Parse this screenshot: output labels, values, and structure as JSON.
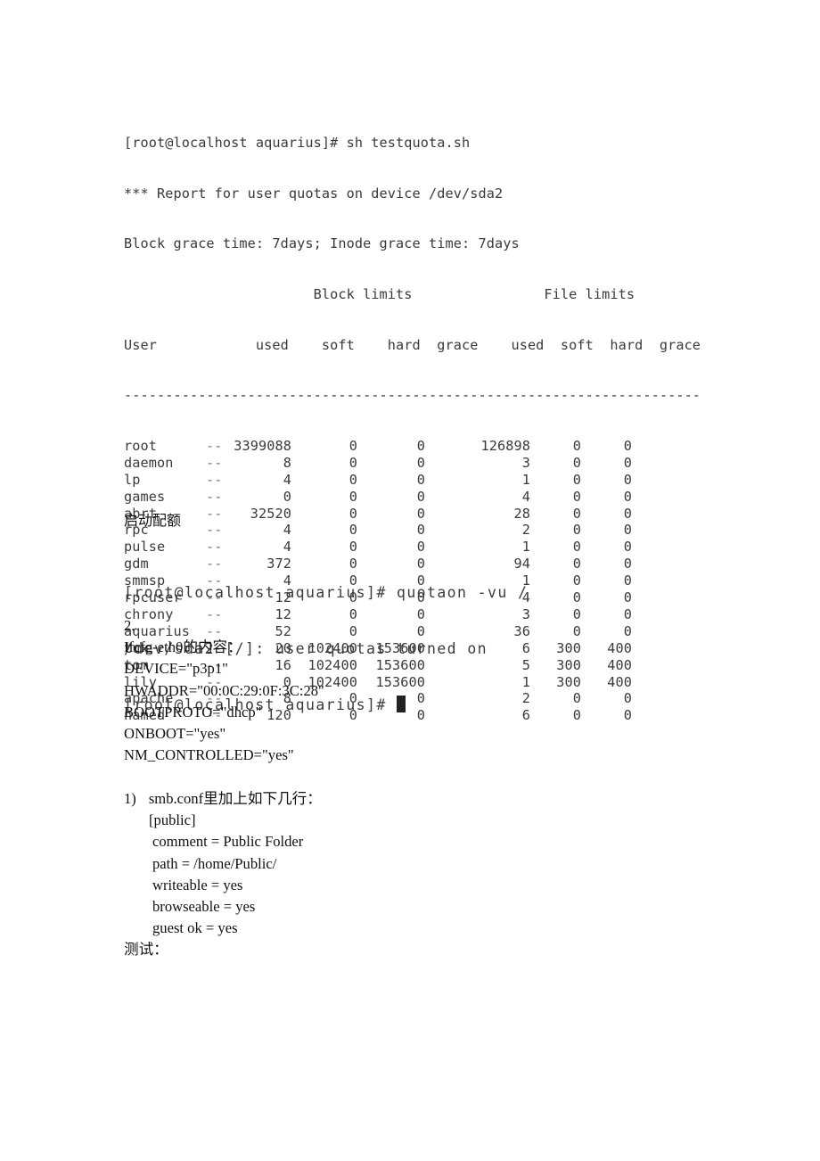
{
  "terminal1": {
    "command_line": "[root@localhost aquarius]# sh testquota.sh",
    "report_line": "*** Report for user quotas on device /dev/sda2",
    "grace_line": "Block grace time: 7days; Inode grace time: 7days",
    "group_header": "                       Block limits                File limits",
    "column_header": "User            used    soft    hard  grace    used  soft  hard  grace",
    "separator": "----------------------------------------------------------------------",
    "rows": [
      {
        "user": "root",
        "flag": "--",
        "block_used": "3399088",
        "block_soft": "0",
        "block_hard": "0",
        "file_used": "126898",
        "file_soft": "0",
        "file_hard": "0"
      },
      {
        "user": "daemon",
        "flag": "--",
        "block_used": "8",
        "block_soft": "0",
        "block_hard": "0",
        "file_used": "3",
        "file_soft": "0",
        "file_hard": "0"
      },
      {
        "user": "lp",
        "flag": "--",
        "block_used": "4",
        "block_soft": "0",
        "block_hard": "0",
        "file_used": "1",
        "file_soft": "0",
        "file_hard": "0"
      },
      {
        "user": "games",
        "flag": "--",
        "block_used": "0",
        "block_soft": "0",
        "block_hard": "0",
        "file_used": "4",
        "file_soft": "0",
        "file_hard": "0"
      },
      {
        "user": "abrt",
        "flag": "--",
        "block_used": "32520",
        "block_soft": "0",
        "block_hard": "0",
        "file_used": "28",
        "file_soft": "0",
        "file_hard": "0"
      },
      {
        "user": "rpc",
        "flag": "--",
        "block_used": "4",
        "block_soft": "0",
        "block_hard": "0",
        "file_used": "2",
        "file_soft": "0",
        "file_hard": "0"
      },
      {
        "user": "pulse",
        "flag": "--",
        "block_used": "4",
        "block_soft": "0",
        "block_hard": "0",
        "file_used": "1",
        "file_soft": "0",
        "file_hard": "0"
      },
      {
        "user": "gdm",
        "flag": "--",
        "block_used": "372",
        "block_soft": "0",
        "block_hard": "0",
        "file_used": "94",
        "file_soft": "0",
        "file_hard": "0"
      },
      {
        "user": "smmsp",
        "flag": "--",
        "block_used": "4",
        "block_soft": "0",
        "block_hard": "0",
        "file_used": "1",
        "file_soft": "0",
        "file_hard": "0"
      },
      {
        "user": "rpcuser",
        "flag": "--",
        "block_used": "12",
        "block_soft": "0",
        "block_hard": "0",
        "file_used": "4",
        "file_soft": "0",
        "file_hard": "0"
      },
      {
        "user": "chrony",
        "flag": "--",
        "block_used": "12",
        "block_soft": "0",
        "block_hard": "0",
        "file_used": "3",
        "file_soft": "0",
        "file_hard": "0"
      },
      {
        "user": "aquarius",
        "flag": "--",
        "block_used": "52",
        "block_soft": "0",
        "block_hard": "0",
        "file_used": "36",
        "file_soft": "0",
        "file_hard": "0"
      },
      {
        "user": "tux",
        "flag": "--",
        "block_used": "20",
        "block_soft": "102400",
        "block_hard": "153600",
        "file_used": "6",
        "file_soft": "300",
        "file_hard": "400"
      },
      {
        "user": "tom",
        "flag": "--",
        "block_used": "16",
        "block_soft": "102400",
        "block_hard": "153600",
        "file_used": "5",
        "file_soft": "300",
        "file_hard": "400"
      },
      {
        "user": "lily",
        "flag": "--",
        "block_used": "0",
        "block_soft": "102400",
        "block_hard": "153600",
        "file_used": "1",
        "file_soft": "300",
        "file_hard": "400"
      },
      {
        "user": "apache",
        "flag": "--",
        "block_used": "8",
        "block_soft": "0",
        "block_hard": "0",
        "file_used": "2",
        "file_soft": "0",
        "file_hard": "0"
      },
      {
        "user": "named",
        "flag": "--",
        "block_used": "120",
        "block_soft": "0",
        "block_hard": "0",
        "file_used": "6",
        "file_soft": "0",
        "file_hard": "0"
      }
    ]
  },
  "heading_enable_quota": "启动配额",
  "terminal2": {
    "lines": [
      "[root@localhost aquarius]# quotaon -vu /",
      "/dev/sda2 [/]: user quotas turned on",
      "[root@localhost aquarius]# "
    ]
  },
  "section2": {
    "number": "2.",
    "ifcfg_title": "Ifcfg-eth0的内容：",
    "ifcfg_lines": [
      "DEVICE=\"p3p1\"",
      "HWADDR=\"00:0C:29:0F:3C:28\"",
      "BOOTPROTO=\"dhcp\"",
      "ONBOOT=\"yes\"",
      "NM_CONTROLLED=\"yes\""
    ]
  },
  "smb": {
    "item_number": "1)",
    "item_text": "smb.conf里加上如下几行：",
    "section_name": "[public]",
    "settings": [
      "comment = Public Folder",
      "path = /home/Public/",
      "writeable = yes",
      "browseable = yes",
      "guest ok = yes"
    ],
    "test_label": "测试："
  }
}
